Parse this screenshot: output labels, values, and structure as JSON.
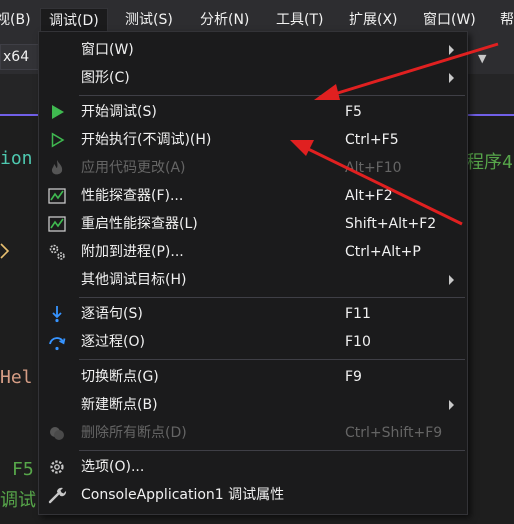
{
  "menubar": {
    "items": [
      "视(B)",
      "调试(D)",
      "测试(S)",
      "分析(N)",
      "工具(T)",
      "扩展(X)",
      "窗口(W)",
      "帮"
    ]
  },
  "toolbar": {
    "platform": "x64"
  },
  "editor": {
    "text1": "ion",
    "text2": "Hel",
    "text3": "F5",
    "text4": "调试",
    "text5": "程序4"
  },
  "menu": {
    "items": [
      {
        "label": "窗口(W)",
        "shortcut": "",
        "submenu": true,
        "disabled": false,
        "icon": ""
      },
      {
        "label": "图形(C)",
        "shortcut": "",
        "submenu": true,
        "disabled": false,
        "icon": ""
      },
      {
        "label": "开始调试(S)",
        "shortcut": "F5",
        "submenu": false,
        "disabled": false,
        "icon": "play-solid-icon"
      },
      {
        "label": "开始执行(不调试)(H)",
        "shortcut": "Ctrl+F5",
        "submenu": false,
        "disabled": false,
        "icon": "play-outline-icon"
      },
      {
        "label": "应用代码更改(A)",
        "shortcut": "Alt+F10",
        "submenu": false,
        "disabled": true,
        "icon": "flame-icon"
      },
      {
        "label": "性能探查器(F)...",
        "shortcut": "Alt+F2",
        "submenu": false,
        "disabled": false,
        "icon": "perf-chart-icon"
      },
      {
        "label": "重启性能探查器(L)",
        "shortcut": "Shift+Alt+F2",
        "submenu": false,
        "disabled": false,
        "icon": "perf-chart-icon"
      },
      {
        "label": "附加到进程(P)...",
        "shortcut": "Ctrl+Alt+P",
        "submenu": false,
        "disabled": false,
        "icon": "gears-icon"
      },
      {
        "label": "其他调试目标(H)",
        "shortcut": "",
        "submenu": true,
        "disabled": false,
        "icon": ""
      },
      {
        "label": "逐语句(S)",
        "shortcut": "F11",
        "submenu": false,
        "disabled": false,
        "icon": "step-into-icon"
      },
      {
        "label": "逐过程(O)",
        "shortcut": "F10",
        "submenu": false,
        "disabled": false,
        "icon": "step-over-icon"
      },
      {
        "label": "切换断点(G)",
        "shortcut": "F9",
        "submenu": false,
        "disabled": false,
        "icon": ""
      },
      {
        "label": "新建断点(B)",
        "shortcut": "",
        "submenu": true,
        "disabled": false,
        "icon": ""
      },
      {
        "label": "删除所有断点(D)",
        "shortcut": "Ctrl+Shift+F9",
        "submenu": false,
        "disabled": true,
        "icon": "delete-breakpoints-icon"
      },
      {
        "label": "选项(O)...",
        "shortcut": "",
        "submenu": false,
        "disabled": false,
        "icon": "gear-icon"
      },
      {
        "label": "ConsoleApplication1 调试属性",
        "shortcut": "",
        "submenu": false,
        "disabled": false,
        "icon": "wrench-icon"
      }
    ]
  },
  "colors": {
    "accent_green": "#3fb950",
    "step_blue": "#3794ff",
    "annotation_red": "#e02020"
  }
}
